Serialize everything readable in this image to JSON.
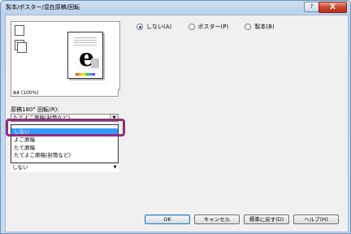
{
  "window": {
    "title": "製本/ポスター/混在原稿/回転",
    "help_label": "?",
    "close_label": "X"
  },
  "preview": {
    "page_letter": "e",
    "size_label": "A4 (100%)"
  },
  "rotation": {
    "label": "原稿180° 回転(R):",
    "value": "たてよこ原稿(封筒など)"
  },
  "dropdown": {
    "options": [
      "しない",
      "よこ原稿",
      "たて原稿",
      "たてよこ原稿(封筒など)"
    ],
    "selected_index": 0
  },
  "lower_combo": {
    "value": "しない"
  },
  "layout_radios": [
    {
      "label": "しない(A)",
      "checked": true
    },
    {
      "label": "ポスター(P)",
      "checked": false
    },
    {
      "label": "製本(B)",
      "checked": false
    }
  ],
  "buttons": {
    "ok": "OK",
    "cancel": "キャンセル",
    "defaults": "標準に戻す(D)",
    "help": "ヘルプ(H)"
  },
  "colors": {
    "highlight_border": "#8e2f7a",
    "selection": "#3399ff"
  }
}
